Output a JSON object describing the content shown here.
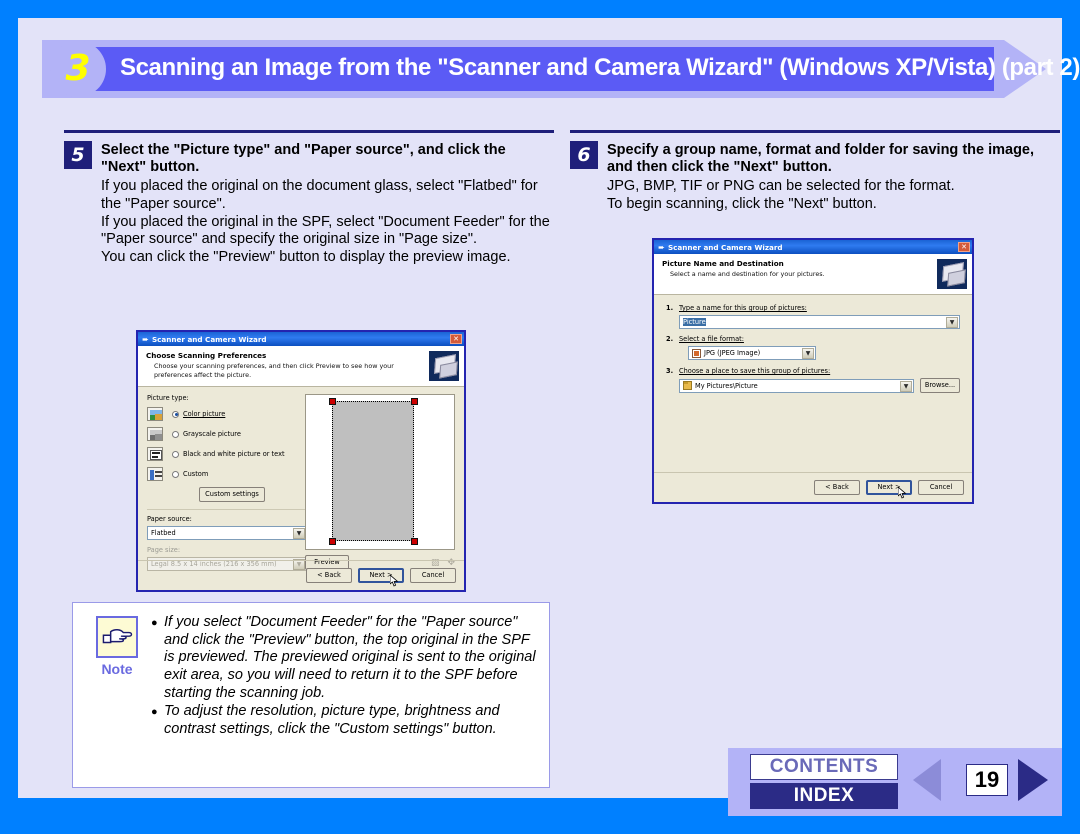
{
  "banner": {
    "step_number": "3",
    "title": "Scanning an Image from the \"Scanner and Camera Wizard\" (Windows XP/Vista) (part 2)"
  },
  "left_column": {
    "step_number": "5",
    "title": "Select the \"Picture type\" and \"Paper source\", and click the \"Next\" button.",
    "body": "If you placed the original on the document glass, select \"Flatbed\" for the \"Paper source\".\nIf you placed the original in the SPF, select \"Document Feeder\" for the \"Paper source\" and specify the original size in \"Page size\".\nYou can click the \"Preview\" button to display the preview image."
  },
  "right_column": {
    "step_number": "6",
    "title": "Specify a group name, format and folder for saving the image, and then click the \"Next\" button.",
    "body": "JPG, BMP, TIF or PNG can be selected for the format.\nTo begin scanning, click the \"Next\" button."
  },
  "dialog_left": {
    "window_title": "Scanner and Camera Wizard",
    "close_label": "✕",
    "heading": "Choose Scanning Preferences",
    "subheading": "Choose your scanning preferences, and then click Preview to see how your preferences affect the picture.",
    "picture_type_label": "Picture type:",
    "options": [
      {
        "label": "Color picture",
        "selected": true
      },
      {
        "label": "Grayscale picture",
        "selected": false
      },
      {
        "label": "Black and white picture or text",
        "selected": false
      },
      {
        "label": "Custom",
        "selected": false
      }
    ],
    "custom_settings_button": "Custom settings",
    "paper_source_label": "Paper source:",
    "paper_source_value": "Flatbed",
    "page_size_label": "Page size:",
    "page_size_value": "Legal 8.5 x 14 inches (216 x 356 mm)",
    "preview_button": "Preview",
    "back_button": "< Back",
    "next_button": "Next >",
    "cancel_button": "Cancel"
  },
  "dialog_right": {
    "window_title": "Scanner and Camera Wizard",
    "close_label": "✕",
    "heading": "Picture Name and Destination",
    "subheading": "Select a name and destination for your pictures.",
    "step1_number": "1.",
    "step1_label": "Type a name for this group of pictures:",
    "step1_value": "Picture",
    "step2_number": "2.",
    "step2_label": "Select a file format:",
    "step2_value": "JPG (JPEG Image)",
    "step3_number": "3.",
    "step3_label": "Choose a place to save this group of pictures:",
    "step3_value": "My Pictures\\Picture",
    "browse_button": "Browse...",
    "back_button": "< Back",
    "next_button": "Next >",
    "cancel_button": "Cancel"
  },
  "note": {
    "label": "Note",
    "icon": "pointing-hand-icon",
    "items": [
      "If you select \"Document Feeder\" for the \"Paper source\" and click the \"Preview\" button, the top original in the SPF is previewed. The previewed original is sent to the original exit area, so you will need to return it to the SPF before starting the scanning job.",
      "To adjust the resolution, picture type, brightness and contrast settings, click the \"Custom settings\" button."
    ]
  },
  "footer": {
    "contents_label": "CONTENTS",
    "index_label": "INDEX",
    "page_number": "19",
    "prev_icon": "left-triangle-icon",
    "next_icon": "right-triangle-icon"
  },
  "colors": {
    "page_border": "#0080ff",
    "page_background": "#e3e3f8",
    "banner_bar": "#5b5bf5",
    "banner_accent": "#b3b3f7",
    "banner_number": "#ffff00",
    "step_badge": "#1f1f7a",
    "index_background": "#2b2b86",
    "contents_text": "#6a6ab8",
    "note_border": "#6a6ae0"
  }
}
